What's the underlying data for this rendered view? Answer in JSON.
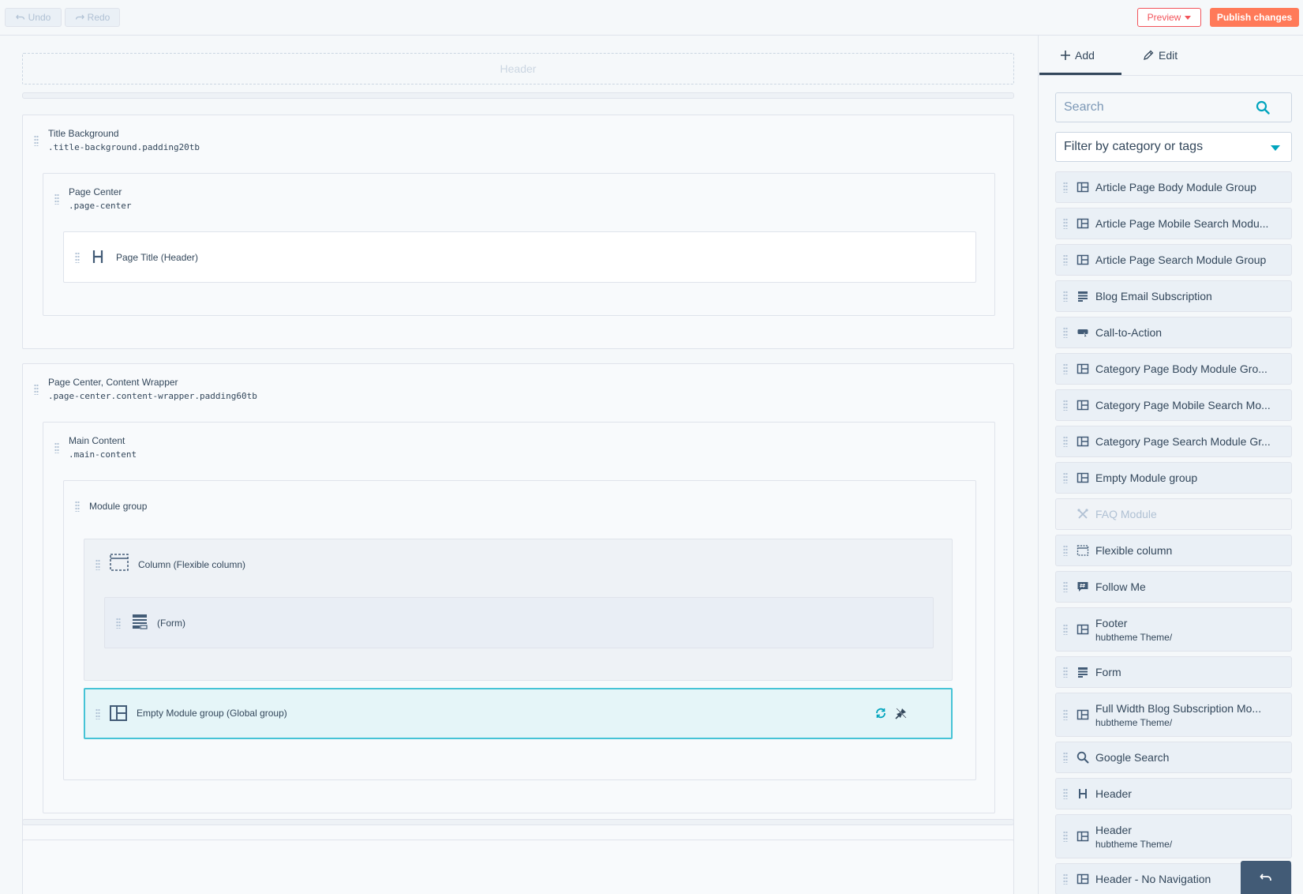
{
  "toolbar": {
    "undo_label": "Undo",
    "redo_label": "Redo",
    "preview_label": "Preview",
    "publish_label": "Publish changes"
  },
  "canvas": {
    "header_placeholder": "Header",
    "rows": {
      "title_background": {
        "label": "Title Background",
        "class": ".title-background.padding20tb"
      },
      "page_center": {
        "label": "Page Center",
        "class": ".page-center"
      },
      "page_title": {
        "label": "Page Title (Header)"
      },
      "content_wrapper": {
        "label": "Page Center, Content Wrapper",
        "class": ".page-center.content-wrapper.padding60tb"
      },
      "main_content": {
        "label": "Main Content",
        "class": ".main-content"
      },
      "module_group": {
        "label": "Module group"
      },
      "column": {
        "label": "Column (Flexible column)"
      },
      "form": {
        "label": "(Form)"
      },
      "empty_global": {
        "label": "Empty Module group (Global group)"
      }
    }
  },
  "panel": {
    "tabs": {
      "add": "Add",
      "edit": "Edit",
      "active": "add"
    },
    "search_placeholder": "Search",
    "filter_label": "Filter by category or tags",
    "modules": [
      {
        "name": "Article Page Body Module Group",
        "icon": "module-group-icon"
      },
      {
        "name": "Article Page Mobile Search Modu...",
        "icon": "module-group-icon"
      },
      {
        "name": "Article Page Search Module Group",
        "icon": "module-group-icon"
      },
      {
        "name": "Blog Email Subscription",
        "icon": "form-icon"
      },
      {
        "name": "Call-to-Action",
        "icon": "cta-icon"
      },
      {
        "name": "Category Page Body Module Gro...",
        "icon": "module-group-icon"
      },
      {
        "name": "Category Page Mobile Search Mo...",
        "icon": "module-group-icon"
      },
      {
        "name": "Category Page Search Module Gr...",
        "icon": "module-group-icon"
      },
      {
        "name": "Empty Module group",
        "icon": "module-group-icon"
      },
      {
        "name": "FAQ Module",
        "icon": "tools-icon",
        "disabled": true
      },
      {
        "name": "Flexible column",
        "icon": "column-icon"
      },
      {
        "name": "Follow Me",
        "icon": "hashtag-icon"
      },
      {
        "name": "Footer",
        "sub": "hubtheme Theme/",
        "icon": "module-group-icon"
      },
      {
        "name": "Form",
        "icon": "form-icon"
      },
      {
        "name": "Full Width Blog Subscription Mo...",
        "sub": "hubtheme Theme/",
        "icon": "module-group-icon"
      },
      {
        "name": "Google Search",
        "icon": "search-icon"
      },
      {
        "name": "Header",
        "icon": "heading-icon"
      },
      {
        "name": "Header",
        "sub": "hubtheme Theme/",
        "icon": "module-group-icon"
      },
      {
        "name": "Header - No Navigation",
        "icon": "module-group-icon"
      }
    ]
  }
}
